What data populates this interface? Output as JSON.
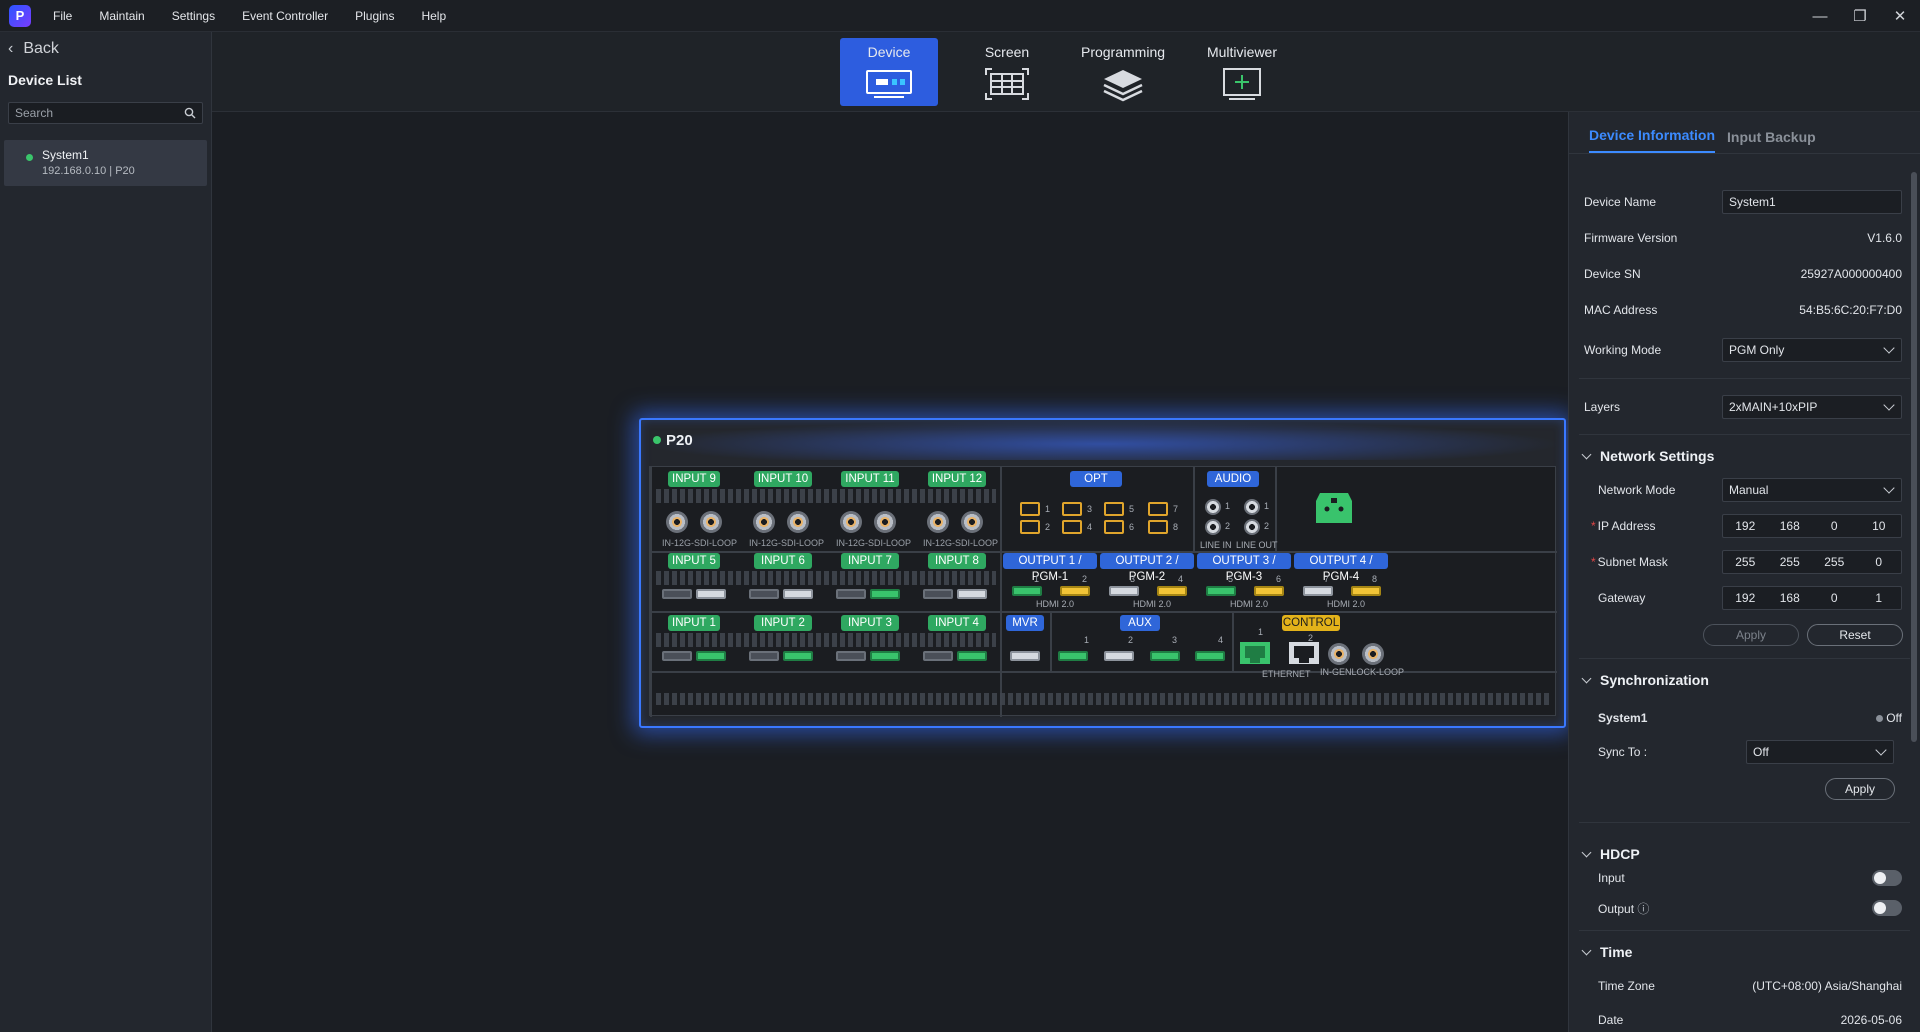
{
  "menubar": {
    "logo": "P",
    "items": [
      "File",
      "Maintain",
      "Settings",
      "Event Controller",
      "Plugins",
      "Help"
    ]
  },
  "window_controls": {
    "minimize": "—",
    "restore": "❐",
    "close": "✕"
  },
  "sidebar": {
    "back_label": "Back",
    "title": "Device List",
    "search_placeholder": "Search",
    "devices": [
      {
        "name": "System1",
        "detail": "192.168.0.10 | P20",
        "status_color": "#3ac56b"
      }
    ]
  },
  "tabs": [
    {
      "label": "Device",
      "active": true
    },
    {
      "label": "Screen",
      "active": false
    },
    {
      "label": "Programming",
      "active": false
    },
    {
      "label": "Multiviewer",
      "active": false
    }
  ],
  "device_panel": {
    "title": "P20",
    "sdi_inputs": [
      "INPUT 9",
      "INPUT 10",
      "INPUT 11",
      "INPUT 12"
    ],
    "sdi_label": "IN-12G-SDI-LOOP",
    "opt_label": "OPT",
    "opt_ports": [
      "1",
      "2",
      "3",
      "4",
      "5",
      "6",
      "7",
      "8"
    ],
    "audio_label": "AUDIO",
    "audio_ports": [
      "1",
      "2",
      "1",
      "2"
    ],
    "line_in": "LINE IN",
    "line_out": "LINE OUT",
    "row2_inputs": [
      "INPUT 5",
      "INPUT 6",
      "INPUT 7",
      "INPUT 8"
    ],
    "outputs": [
      "OUTPUT 1 / PGM-1",
      "OUTPUT 2 / PGM-2",
      "OUTPUT 3 / PGM-3",
      "OUTPUT 4 / PGM-4"
    ],
    "output_ports": [
      "1",
      "2",
      "3",
      "4",
      "5",
      "6",
      "7",
      "8"
    ],
    "hdmi_label": "HDMI 2.0",
    "row3_inputs": [
      "INPUT 1",
      "INPUT 2",
      "INPUT 3",
      "INPUT 4"
    ],
    "mvr_label": "MVR",
    "aux_label": "AUX",
    "aux_ports": [
      "1",
      "2",
      "3",
      "4"
    ],
    "control_label": "CONTROL",
    "ethernet_ports": [
      "1",
      "2"
    ],
    "ethernet_label": "ETHERNET",
    "genlock_label": "IN-GENLOCK-LOOP"
  },
  "right_panel": {
    "tabs": [
      "Device Information",
      "Input Backup"
    ],
    "device_name_label": "Device Name",
    "device_name_value": "System1",
    "firmware_label": "Firmware Version",
    "firmware_value": "V1.6.0",
    "sn_label": "Device SN",
    "sn_value": "25927A000000400",
    "mac_label": "MAC Address",
    "mac_value": "54:B5:6C:20:F7:D0",
    "working_mode_label": "Working Mode",
    "working_mode_value": "PGM Only",
    "layers_label": "Layers",
    "layers_value": "2xMAIN+10xPIP",
    "network": {
      "title": "Network Settings",
      "mode_label": "Network Mode",
      "mode_value": "Manual",
      "ip_label": "IP Address",
      "ip": [
        "192",
        "168",
        "0",
        "10"
      ],
      "mask_label": "Subnet Mask",
      "mask": [
        "255",
        "255",
        "255",
        "0"
      ],
      "gateway_label": "Gateway",
      "gateway": [
        "192",
        "168",
        "0",
        "1"
      ],
      "apply": "Apply",
      "reset": "Reset"
    },
    "sync": {
      "title": "Synchronization",
      "device": "System1",
      "status": "Off",
      "sync_to_label": "Sync To :",
      "sync_to_value": "Off",
      "apply": "Apply"
    },
    "hdcp": {
      "title": "HDCP",
      "input_label": "Input",
      "output_label": "Output",
      "info_icon": "ⓘ"
    },
    "time": {
      "title": "Time",
      "zone_label": "Time Zone",
      "zone_value": "(UTC+08:00) Asia/Shanghai",
      "date_label": "Date",
      "date_value": "2026-05-06"
    }
  }
}
